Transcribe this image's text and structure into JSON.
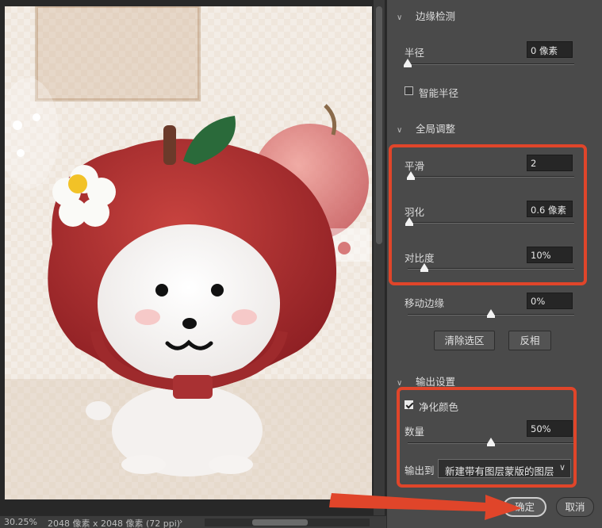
{
  "panel": {
    "edge_detection": {
      "title": "边缘检测",
      "radius_label": "半径",
      "radius_value": "0 像素",
      "radius_level": 0,
      "smart_radius_label": "智能半径",
      "smart_radius_checked": false
    },
    "global_refinements": {
      "title": "全局调整",
      "smooth_label": "平滑",
      "smooth_value": "2",
      "smooth_level": 0.02,
      "feather_label": "羽化",
      "feather_value": "0.6 像素",
      "feather_level": 0.01,
      "contrast_label": "对比度",
      "contrast_value": "10%",
      "contrast_level": 0.1,
      "shift_edge_label": "移动边缘",
      "shift_edge_value": "0%",
      "shift_edge_level": 0.5,
      "clear_selection_label": "清除选区",
      "invert_label": "反相"
    },
    "output_settings": {
      "title": "输出设置",
      "decontaminate_label": "净化颜色",
      "decontaminate_checked": true,
      "amount_label": "数量",
      "amount_value": "50%",
      "amount_level": 0.5,
      "output_to_label": "输出到",
      "output_to_value": "新建带有图层蒙版的图层"
    },
    "ok_label": "确定",
    "cancel_label": "取消"
  },
  "status_bar": {
    "zoom": "30.25%",
    "doc_info": "2048 像素 x 2048 像素 (72 ppi)"
  },
  "colors": {
    "panel_bg": "#4a4a4a",
    "annotation_red": "#e0452a",
    "field_bg": "#262626"
  },
  "icons": [
    "chevron-down-icon",
    "checkbox-icon",
    "dropdown-chevron-icon",
    "arrow-annotation",
    "apple-plush-photo"
  ]
}
